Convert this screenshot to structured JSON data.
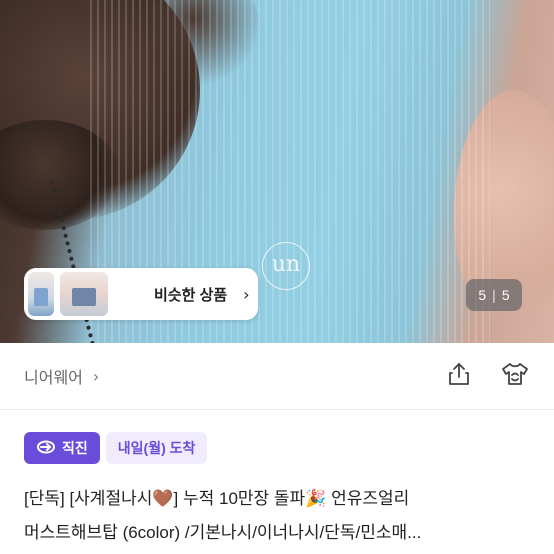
{
  "gallery": {
    "logo_text": "un",
    "similar": {
      "label": "비슷한 상품",
      "chevron": "›"
    },
    "pager": {
      "current": "5",
      "separator": "|",
      "total": "5"
    }
  },
  "brand": {
    "name": "니어웨어",
    "chevron": "›"
  },
  "icons": {
    "share": "share-icon",
    "fitting": "tshirt-fitting-icon",
    "direct": "direct-ship-icon"
  },
  "badges": {
    "direct": "직진",
    "arrival": "내일(월) 도착"
  },
  "product": {
    "title_line1": "[단독] [사계절나시🤎] 누적 10만장 돌파🎉 언유즈얼리",
    "title_line2": "머스트해브탑 (6color) /기본나시/이너나시/단독/민소매..."
  },
  "colors": {
    "accent": "#6a4cdb",
    "accent_light": "#f0ecfd",
    "shirt": "#8fc9de"
  }
}
